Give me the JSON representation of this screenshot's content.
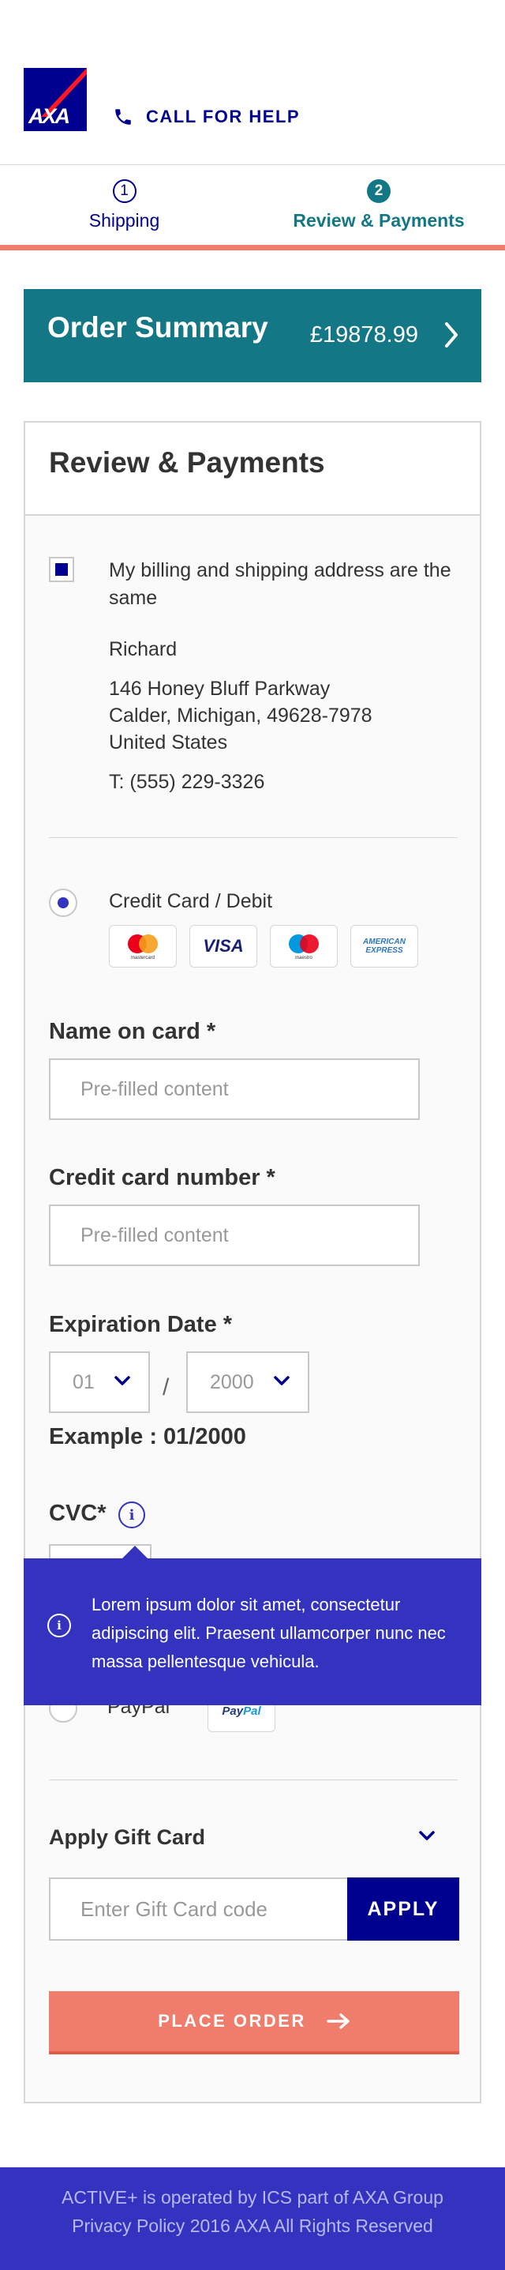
{
  "header": {
    "logo_text": "AXA",
    "help_label": "CALL FOR HELP",
    "help_icon": "phone-icon"
  },
  "stepper": {
    "steps": [
      {
        "number": "1",
        "label": "Shipping",
        "state": "done"
      },
      {
        "number": "2",
        "label": "Review & Payments",
        "state": "current"
      }
    ]
  },
  "summary": {
    "title": "Order Summary",
    "total": "£19878.99"
  },
  "review": {
    "title": "Review & Payments",
    "same_address_label": "My billing and shipping address are the same",
    "same_address_checked": true,
    "address": {
      "name": "Richard",
      "street": "146 Honey Bluff Parkway",
      "city_line": "Calder, Michigan, 49628-7978",
      "country": "United States",
      "phone": "T: (555) 229-3326"
    }
  },
  "payment": {
    "card_option_label": "Credit Card / Debit",
    "card_option_selected": true,
    "card_brands": [
      "mastercard",
      "VISA",
      "maestro",
      "AMERICAN EXPRESS"
    ],
    "name_label": "Name on card *",
    "name_value": "Pre-filled content",
    "number_label": "Credit card number *",
    "number_value": "Pre-filled content",
    "expiry_label": "Expiration Date *",
    "expiry_month": "01",
    "expiry_separator": "/",
    "expiry_year": "2000",
    "expiry_example": "Example : 01/2000",
    "cvc_label": "CVC*",
    "paypal_label": "PayPal",
    "paypal_badge": {
      "pay": "Pay",
      "pal": "Pal"
    }
  },
  "tooltip": {
    "text": "Lorem ipsum dolor sit amet, consectetur adipiscing elit. Praesent ullamcorper nunc nec massa pellentesque vehicula."
  },
  "gift": {
    "title": "Apply Gift Card",
    "placeholder": "Enter Gift Card code",
    "apply_label": "APPLY"
  },
  "place_order_label": "PLACE ORDER",
  "footer": {
    "line1": "ACTIVE+ is operated by ICS part of AXA Group",
    "line2": "Privacy Policy 2016 AXA All Rights Reserved"
  },
  "colors": {
    "brand_blue": "#00008f",
    "teal": "#137785",
    "coral": "#f07c6c",
    "tooltip_blue": "#3333c0"
  }
}
